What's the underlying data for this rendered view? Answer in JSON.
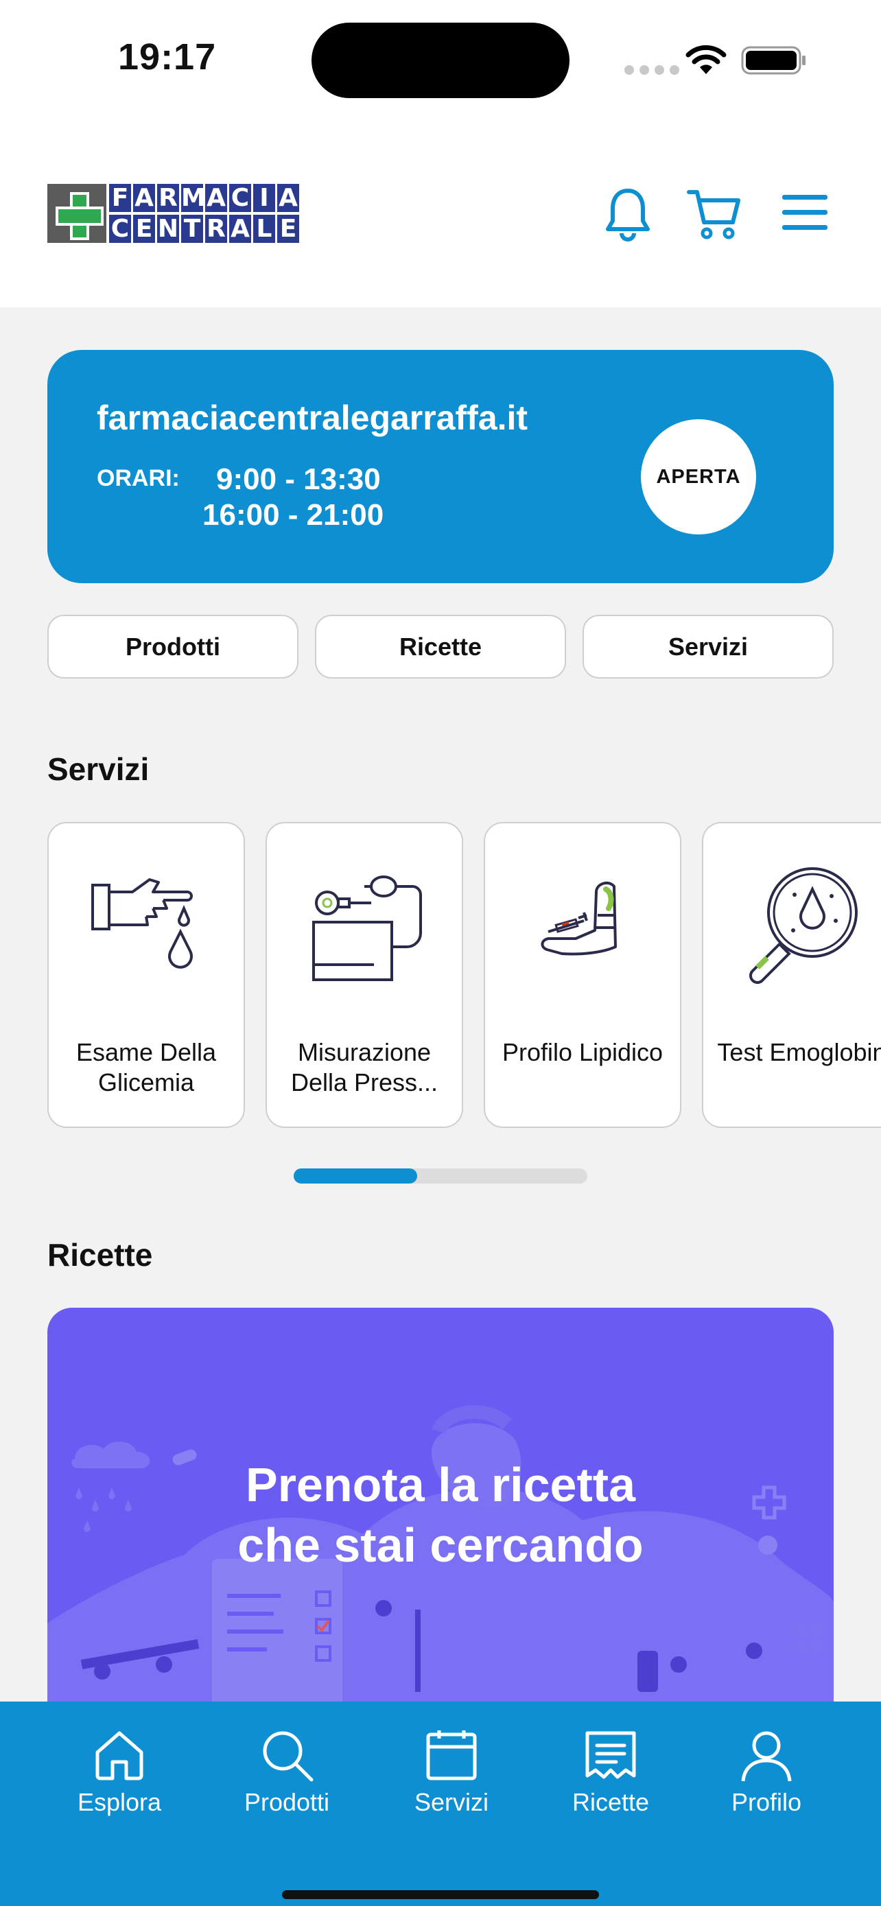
{
  "status": {
    "time": "19:17"
  },
  "header": {
    "logo_line1": [
      "F",
      "A",
      "R",
      "M",
      "A",
      "C",
      "I",
      "A"
    ],
    "logo_line2": [
      "C",
      "E",
      "N",
      "T",
      "R",
      "A",
      "L",
      "E"
    ]
  },
  "info": {
    "website": "farmaciacentralegarraffa.it",
    "hours_label": "ORARI:",
    "hours_morning": "9:00 - 13:30",
    "hours_afternoon": "16:00 - 21:00",
    "status_badge": "APERTA"
  },
  "quick_links": [
    "Prodotti",
    "Ricette",
    "Servizi"
  ],
  "services": {
    "title": "Servizi",
    "items": [
      {
        "label": "Esame Della Glicemia",
        "icon": "glucose-test-icon"
      },
      {
        "label": "Misurazione Della Press...",
        "icon": "blood-pressure-icon"
      },
      {
        "label": "Profilo Lipidico",
        "icon": "lipid-profile-icon"
      },
      {
        "label": "Test Emoglobin...",
        "icon": "hemoglobin-test-icon"
      }
    ],
    "scroll_progress": 0.42
  },
  "recipes": {
    "title": "Ricette",
    "promo_line1": "Prenota la ricetta",
    "promo_line2": "che stai cercando"
  },
  "tabs": [
    {
      "label": "Esplora",
      "icon": "home-icon"
    },
    {
      "label": "Prodotti",
      "icon": "search-icon"
    },
    {
      "label": "Servizi",
      "icon": "calendar-icon"
    },
    {
      "label": "Ricette",
      "icon": "receipt-icon"
    },
    {
      "label": "Profilo",
      "icon": "user-icon"
    }
  ],
  "colors": {
    "primary": "#0e8fd1",
    "promo": "#6a5cf2",
    "logo_blue": "#2a3b8f",
    "logo_green": "#2fa84f"
  }
}
